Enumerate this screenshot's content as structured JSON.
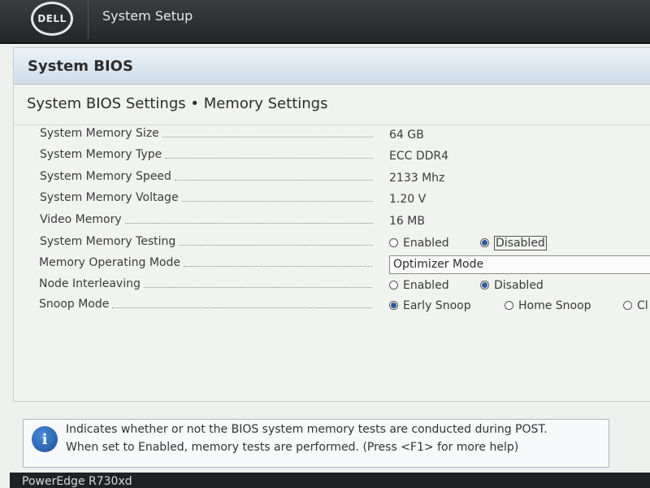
{
  "header": {
    "logo_text": "DELL",
    "title": "System Setup"
  },
  "panel": {
    "title": "System BIOS"
  },
  "section": {
    "title": "System BIOS Settings • Memory Settings"
  },
  "settings": {
    "memory_size": {
      "label": "System Memory Size",
      "value": "64 GB"
    },
    "memory_type": {
      "label": "System Memory Type",
      "value": "ECC DDR4"
    },
    "memory_speed": {
      "label": "System Memory Speed",
      "value": "2133 Mhz"
    },
    "memory_voltage": {
      "label": "System Memory Voltage",
      "value": "1.20 V"
    },
    "video_memory": {
      "label": "Video Memory",
      "value": "16 MB"
    },
    "memory_testing": {
      "label": "System Memory Testing",
      "options": [
        "Enabled",
        "Disabled"
      ],
      "selected": "Disabled"
    },
    "operating_mode": {
      "label": "Memory Operating Mode",
      "value": "Optimizer Mode"
    },
    "node_interleaving": {
      "label": "Node Interleaving",
      "options": [
        "Enabled",
        "Disabled"
      ],
      "selected": "Disabled"
    },
    "snoop_mode": {
      "label": "Snoop Mode",
      "options": [
        "Early Snoop",
        "Home Snoop",
        "Cl"
      ],
      "selected": "Early Snoop"
    }
  },
  "help": {
    "icon": "info-icon",
    "line1": "Indicates whether or not the BIOS system memory tests are conducted during POST.",
    "line2": "When set to Enabled, memory tests are performed. (Press <F1> for more help)"
  },
  "footer": {
    "model": "PowerEdge R730xd"
  },
  "colors": {
    "accent": "#2a5aa0",
    "header_bg": "#2b2e31",
    "panel_header": "#cfdde8"
  }
}
